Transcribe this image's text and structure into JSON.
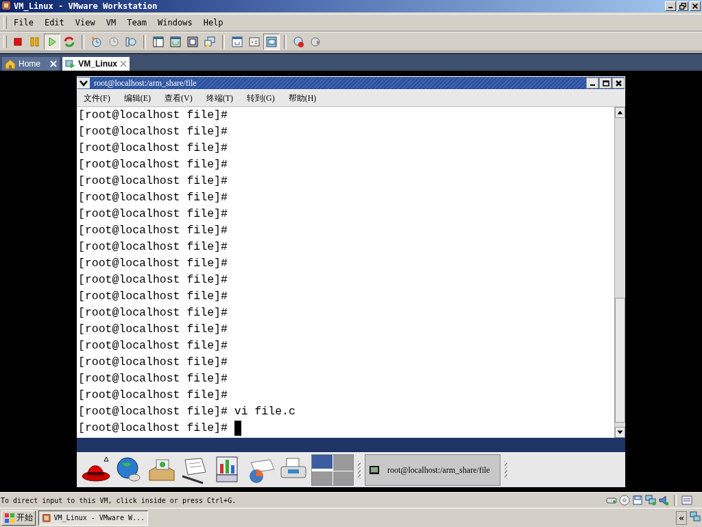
{
  "window": {
    "title": "VM_Linux - VMware Workstation"
  },
  "menu": [
    "File",
    "Edit",
    "View",
    "VM",
    "Team",
    "Windows",
    "Help"
  ],
  "toolbar": [
    [
      {
        "kind": "stop",
        "pressed": false
      },
      {
        "kind": "pause",
        "pressed": false
      },
      {
        "kind": "play",
        "pressed": true
      },
      {
        "kind": "reset",
        "pressed": false
      }
    ],
    [
      {
        "kind": "snapshot",
        "pressed": false
      },
      {
        "kind": "revert",
        "pressed": false
      },
      {
        "kind": "manager",
        "pressed": false
      }
    ],
    [
      {
        "kind": "sidebar",
        "pressed": false
      },
      {
        "kind": "fullscreen",
        "pressed": false
      },
      {
        "kind": "quickswitch",
        "pressed": false
      },
      {
        "kind": "unity",
        "pressed": false
      }
    ],
    [
      {
        "kind": "settings",
        "pressed": false
      },
      {
        "kind": "console",
        "pressed": false
      },
      {
        "kind": "fitwindow",
        "pressed": true
      }
    ],
    [
      {
        "kind": "record",
        "pressed": false
      },
      {
        "kind": "replay",
        "pressed": false
      }
    ]
  ],
  "tabs": [
    {
      "label": "Home",
      "kind": "home",
      "selected": false
    },
    {
      "label": "VM_Linux",
      "kind": "vm",
      "selected": true
    }
  ],
  "guest": {
    "terminal_window": {
      "title": "root@localhost:/arm_share/file",
      "menu": [
        "文件(F)",
        "编辑(E)",
        "查看(V)",
        "终端(T)",
        "转到(G)",
        "帮助(H)"
      ],
      "lines": [
        "[root@localhost file]#",
        "[root@localhost file]#",
        "[root@localhost file]#",
        "[root@localhost file]#",
        "[root@localhost file]#",
        "[root@localhost file]#",
        "[root@localhost file]#",
        "[root@localhost file]#",
        "[root@localhost file]#",
        "[root@localhost file]#",
        "[root@localhost file]#",
        "[root@localhost file]#",
        "[root@localhost file]#",
        "[root@localhost file]#",
        "[root@localhost file]#",
        "[root@localhost file]#",
        "[root@localhost file]#",
        "[root@localhost file]#",
        "[root@localhost file]# vi file.c",
        "[root@localhost file]#"
      ],
      "cursor": true
    },
    "panel": {
      "launchers": [
        {
          "kind": "redhat"
        },
        {
          "kind": "web"
        },
        {
          "kind": "mail"
        },
        {
          "kind": "writer"
        },
        {
          "kind": "impress"
        },
        {
          "kind": "calc"
        },
        {
          "kind": "print"
        }
      ],
      "workspaces": [
        {
          "selected": true
        },
        {
          "selected": false
        },
        {
          "selected": false
        },
        {
          "selected": false
        }
      ],
      "task": "root@localhost:/arm_share/file"
    }
  },
  "status_bar": {
    "text": "To direct input to this VM, click inside or press Ctrl+G.",
    "devices": [
      {
        "kind": "hdd"
      },
      {
        "kind": "cdrom"
      },
      {
        "kind": "floppy"
      },
      {
        "kind": "network"
      },
      {
        "kind": "sound"
      }
    ]
  },
  "taskbar": {
    "start": "开始",
    "task": "VM_Linux - VMware W...",
    "tray_toggle": "«"
  }
}
